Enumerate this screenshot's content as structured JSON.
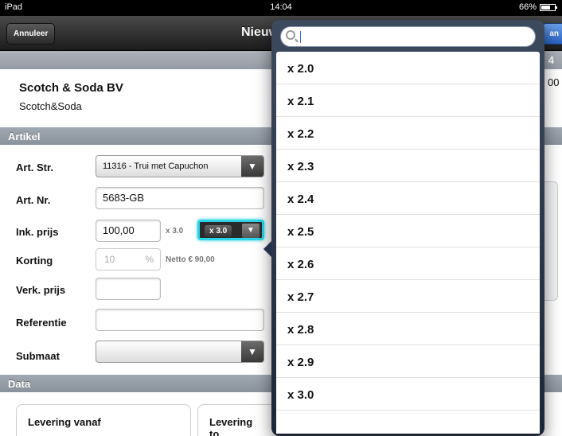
{
  "status": {
    "device": "iPad",
    "time": "14:04",
    "battery": "66%"
  },
  "nav": {
    "cancel": "Annuleer",
    "title": "Nieuw",
    "save_partial": "an"
  },
  "band": {
    "right_number": "4"
  },
  "company": {
    "name": "Scotch & Soda BV",
    "short": "Scotch&Soda",
    "right_value": "00"
  },
  "sections": {
    "artikel": "Artikel",
    "data": "Data"
  },
  "form": {
    "art_str_label": "Art. Str.",
    "art_str_value": "11316 - Trui met Capuchon",
    "art_nr_label": "Art. Nr.",
    "art_nr_value": "5683-GB",
    "ink_label": "Ink. prijs",
    "ink_value": "100,00",
    "ink_mult_text": "x 3.0",
    "mult_button": "x 3.0",
    "korting_label": "Korting",
    "korting_placeholder": "10",
    "korting_unit": "%",
    "netto": "Netto € 90,00",
    "verk_label": "Verk. prijs",
    "ref_label": "Referentie",
    "submaat_label": "Submaat"
  },
  "data_cards": {
    "from": "Levering vanaf",
    "to": "Levering to"
  },
  "picker": {
    "items": [
      "x 2.0",
      "x 2.1",
      "x 2.2",
      "x 2.3",
      "x 2.4",
      "x 2.5",
      "x 2.6",
      "x 2.7",
      "x 2.8",
      "x 2.9",
      "x 3.0"
    ]
  }
}
